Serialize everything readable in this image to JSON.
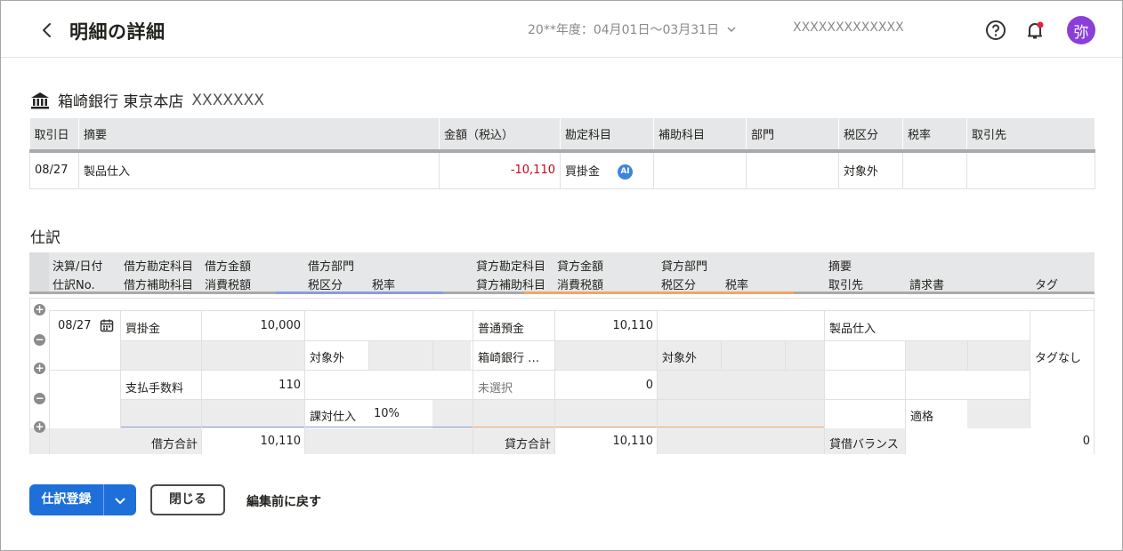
{
  "header": {
    "title": "明細の詳細",
    "period": "20**年度：04月01日〜03月31日",
    "company": "XXXXXXXXXXXXX",
    "avatar": "弥",
    "icons": [
      "back-arrow-icon",
      "help-icon",
      "bell-icon",
      "chevron-down-icon"
    ],
    "notification_dot_color": "#e5213e"
  },
  "bank": {
    "name": "箱崎銀行 東京本店",
    "account": "XXXXXXX"
  },
  "transaction": {
    "columns": [
      "取引日",
      "摘要",
      "金額（税込）",
      "勘定科目",
      "補助科目",
      "部門",
      "税区分",
      "税率",
      "取引先"
    ],
    "row": {
      "date": "08/27",
      "desc": "製品仕入",
      "amount": "-10,110",
      "account": "買掛金",
      "ai_badge": "AI",
      "sub": "",
      "dept": "",
      "tax": "対象外",
      "rate": "",
      "partner": ""
    }
  },
  "journal": {
    "section_title": "仕訳",
    "header_top": [
      "決算/日付",
      "借方勘定科目",
      "借方金額",
      "借方部門",
      "貸方勘定科目",
      "貸方金額",
      "貸方部門",
      "摘要"
    ],
    "header_bottom": [
      "仕訳No.",
      "借方補助科目",
      "消費税額",
      "税区分",
      "税率",
      "貸方補助科目",
      "消費税額",
      "税区分",
      "税率",
      "取引先",
      "請求書",
      "タグ"
    ],
    "rows": {
      "date": "08/27",
      "r1": {
        "debit_account": "買掛金",
        "debit_amount": "10,000",
        "credit_account": "普通預金",
        "credit_amount": "10,110",
        "desc": "製品仕入"
      },
      "r2": {
        "debit_tax": "対象外",
        "credit_sub": "箱崎銀行 …",
        "credit_tax": "対象外",
        "tag": "タグなし"
      },
      "r3": {
        "debit_account": "支払手数料",
        "debit_amount": "110",
        "credit_account": "未選択",
        "credit_amount": "0"
      },
      "r4": {
        "debit_tax": "課対仕入",
        "debit_rate": "10%",
        "invoice": "適格"
      }
    },
    "totals": {
      "debit_label": "借方合計",
      "debit_total": "10,110",
      "credit_label": "貸方合計",
      "credit_total": "10,110",
      "balance_label": "貸借バランス",
      "balance": "0"
    }
  },
  "buttons": {
    "register": "仕訳登録",
    "close": "閉じる",
    "revert": "編集前に戻す"
  },
  "colors": {
    "primary": "#1e6fd9",
    "avatar": "#8a3fd9",
    "negative": "#d0021b",
    "debit_accent": "#8d9bd8",
    "credit_accent": "#f2a46b"
  }
}
